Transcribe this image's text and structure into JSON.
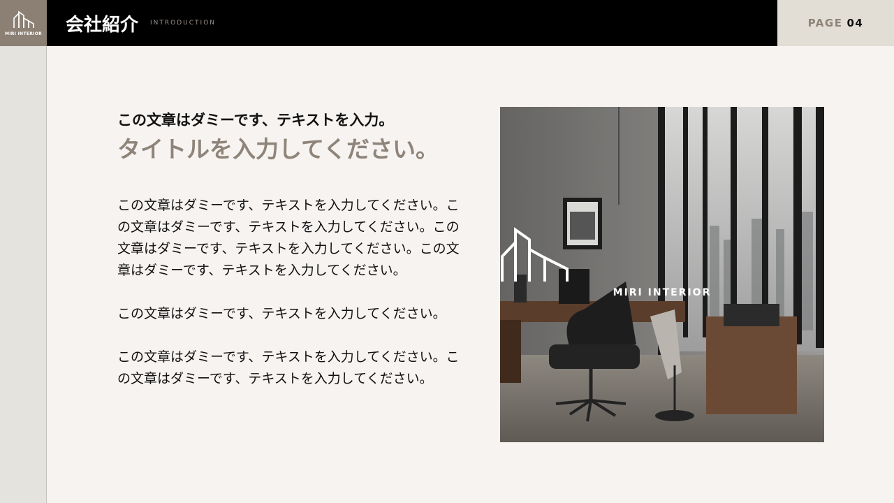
{
  "brand": {
    "logo_text": "MIRI INTERIOR"
  },
  "header": {
    "title": "会社紹介",
    "subtitle": "INTRODUCTION"
  },
  "page": {
    "label": "PAGE",
    "number": "04"
  },
  "content": {
    "lead": "この文章はダミーです、テキストを入力。",
    "heading": "タイトルを入力してください。",
    "paragraphs": [
      "この文章はダミーです、テキストを入力してください。この文章はダミーです、テキストを入力してください。この文章はダミーです、テキストを入力してください。この文章はダミーです、テキストを入力してください。",
      "この文章はダミーです、テキストを入力してください。",
      "この文章はダミーです、テキストを入力してください。この文章はダミーです、テキストを入力してください。"
    ]
  },
  "photo": {
    "logo_text": "MIRI INTERIOR"
  },
  "colors": {
    "header_bg": "#000000",
    "logo_bg": "#8c7f74",
    "page_box_bg": "#e2ddd5",
    "heading": "#8f847a",
    "background": "#f6f3f1"
  }
}
